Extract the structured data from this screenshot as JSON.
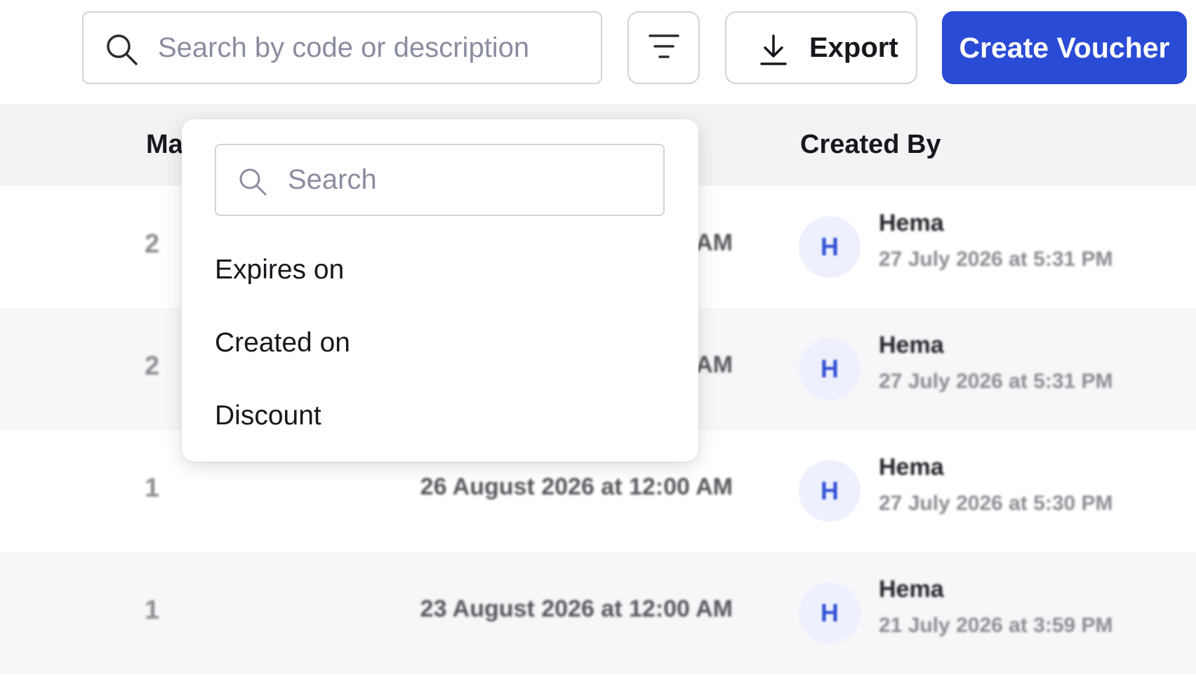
{
  "toolbar": {
    "search_placeholder": "Search by code or description",
    "filter_icon": "filter-lines-icon",
    "export_label": "Export",
    "export_icon": "download-icon",
    "create_label": "Create Voucher",
    "accent_color": "#2a4bd6"
  },
  "table": {
    "headers": {
      "partial_left": "Ma",
      "created_by": "Created By"
    },
    "rows": [
      {
        "count": "2",
        "expires": "AM",
        "avatar_initial": "H",
        "creator_name": "Hema",
        "created_at": "27 July 2026 at 5:31 PM"
      },
      {
        "count": "2",
        "expires": "AM",
        "avatar_initial": "H",
        "creator_name": "Hema",
        "created_at": "27 July 2026 at 5:31 PM"
      },
      {
        "count": "1",
        "expires": "26 August 2026 at 12:00 AM",
        "avatar_initial": "H",
        "creator_name": "Hema",
        "created_at": "27 July 2026 at 5:30 PM"
      },
      {
        "count": "1",
        "expires": "23 August 2026 at 12:00 AM",
        "avatar_initial": "H",
        "creator_name": "Hema",
        "created_at": "21 July 2026 at 3:59 PM"
      }
    ]
  },
  "dropdown": {
    "search_placeholder": "Search",
    "items": [
      "Expires on",
      "Created on",
      "Discount"
    ]
  }
}
